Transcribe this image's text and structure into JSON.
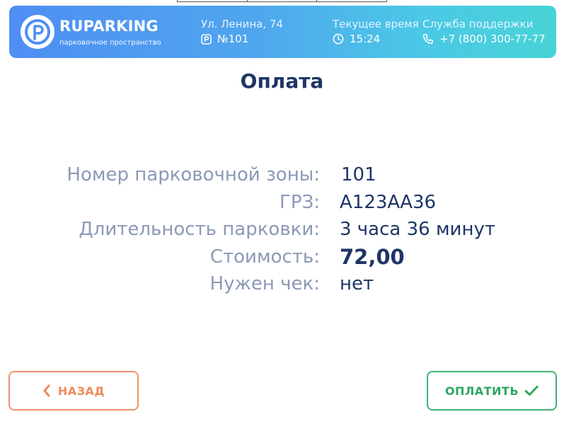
{
  "header": {
    "brand_name": "RUPARKING",
    "brand_sub": "парковочное пространство",
    "address_label": "Ул. Ленина, 74",
    "zone_number": "№101",
    "time_label": "Текущее время",
    "time_value": "15:24",
    "support_label": "Служба поддержки",
    "support_phone": "+7 (800) 300-77-77",
    "icons": {
      "logo": "parking-p-logo-icon",
      "zone": "parking-sign-icon",
      "time": "clock-icon",
      "phone": "phone-icon"
    }
  },
  "page": {
    "title": "Оплата"
  },
  "details": [
    {
      "label": "Номер парковочной зоны:",
      "value": "101"
    },
    {
      "label": "ГРЗ:",
      "value": "А123АА36"
    },
    {
      "label": "Длительность парковки:",
      "value": "3 часа 36 минут"
    },
    {
      "label": "Стоимость:",
      "value": "72,00"
    },
    {
      "label": "Нужен чек:",
      "value": "нет"
    }
  ],
  "buttons": {
    "back_label": "НАЗАД",
    "pay_label": "ОПЛАТИТЬ"
  },
  "colors": {
    "header_gradient_start": "#4f8ef3",
    "header_gradient_end": "#48d3d6",
    "title": "#1f3566",
    "label": "#8b99b8",
    "back_accent": "#ee8a5c",
    "pay_accent": "#2ea765"
  }
}
